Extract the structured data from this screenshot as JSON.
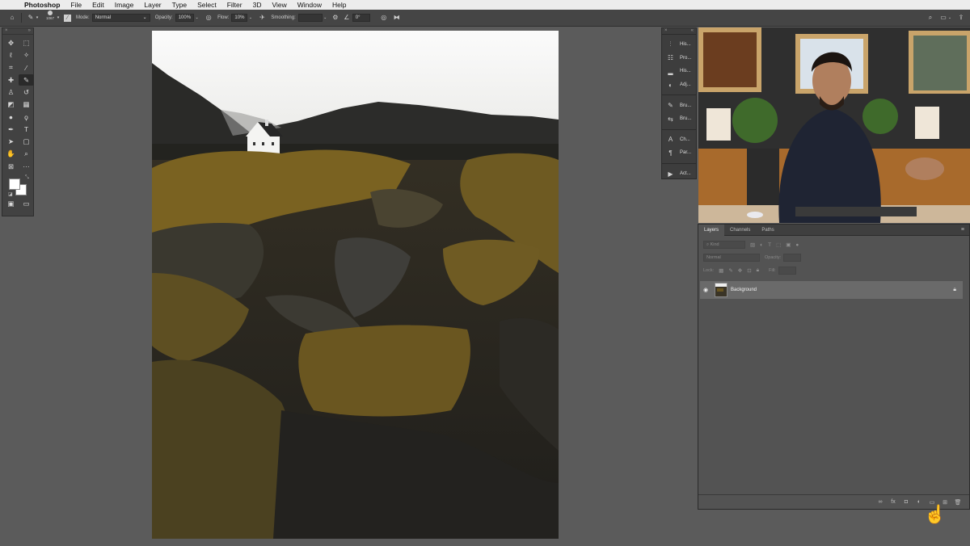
{
  "menubar": {
    "apple": "",
    "app": "Photoshop",
    "items": [
      "File",
      "Edit",
      "Image",
      "Layer",
      "Type",
      "Select",
      "Filter",
      "3D",
      "View",
      "Window",
      "Help"
    ]
  },
  "options": {
    "brush_size": "1067",
    "mode_label": "Mode:",
    "mode_value": "Normal",
    "opacity_label": "Opacity:",
    "opacity_value": "100%",
    "flow_label": "Flow:",
    "flow_value": "10%",
    "smoothing_label": "Smoothing:",
    "smoothing_value": "",
    "angle_value": "0°"
  },
  "collapsed_panels": [
    {
      "label": "His...",
      "icon": "brush-history-icon"
    },
    {
      "label": "Pro...",
      "icon": "properties-icon"
    },
    {
      "label": "His...",
      "icon": "histogram-icon"
    },
    {
      "label": "Adj...",
      "icon": "adjustments-icon"
    },
    {
      "label": "Bru...",
      "icon": "brush-icon"
    },
    {
      "label": "Bru...",
      "icon": "brush-settings-icon"
    },
    {
      "label": "Ch...",
      "icon": "character-icon"
    },
    {
      "label": "Par...",
      "icon": "paragraph-icon"
    },
    {
      "label": "Act...",
      "icon": "actions-icon"
    }
  ],
  "layers_panel": {
    "tabs": [
      "Layers",
      "Channels",
      "Paths"
    ],
    "active_tab": "Layers",
    "filter_placeholder": "Kind",
    "blend_mode": "Normal",
    "opacity_label": "Opacity:",
    "lock_label": "Lock:",
    "fill_label": "Fill:",
    "layers": [
      {
        "name": "Background",
        "visible": true,
        "locked": true
      }
    ]
  },
  "colors": {
    "foreground": "#ffffff",
    "background": "#ffffff",
    "ui_dark": "#424242",
    "workspace": "#5b5b5b"
  }
}
